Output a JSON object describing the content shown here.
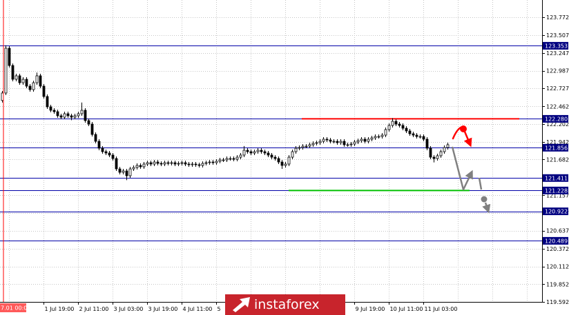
{
  "logo": {
    "text": "instaforex"
  },
  "colors": {
    "background": "#ffffff",
    "grid": "#c4c4c4",
    "axis_line": "#000000",
    "axis_text": "#000000",
    "level_line": "#0000a8",
    "level_label_bg": "#000080",
    "level_label_text": "#ffffff",
    "bull_body": "#ffffff",
    "bear_body": "#000000",
    "candle_outline": "#000000",
    "period_separator": "#ff0000",
    "period_label_bg": "#ff5a5a",
    "period_label_text": "#ffffff",
    "resistance": "#ff0000",
    "support": "#00c000",
    "forecast_arrow_red": "#ff0000",
    "forecast_arrow_gray": "#808080",
    "logo_bg": "#c8242c",
    "logo_text": "#ffffff"
  },
  "chart_data": {
    "type": "bar",
    "style": "candlestick",
    "ylim": [
      119.592,
      124.025
    ],
    "grid": true,
    "y_ticks": [
      "123.772",
      "123.507",
      "123.247",
      "122.987",
      "122.727",
      "122.462",
      "122.202",
      "121.942",
      "121.682",
      "121.157",
      "120.897",
      "120.637",
      "120.372",
      "120.112",
      "119.852",
      "119.592"
    ],
    "x_ticks": [
      {
        "label": "1 Jul 19:00",
        "index": 12
      },
      {
        "label": "2 Jul 11:00",
        "index": 22
      },
      {
        "label": "3 Jul 03:00",
        "index": 32
      },
      {
        "label": "3 Jul 19:00",
        "index": 42
      },
      {
        "label": "4 Jul 11:00",
        "index": 52
      },
      {
        "label": "5",
        "index": 62
      },
      {
        "label": "9 Jul 19:00",
        "index": 102
      },
      {
        "label": "10 Jul 11:00",
        "index": 112
      },
      {
        "label": "11 Jul 03:00",
        "index": 122
      }
    ],
    "period_separator": {
      "label": "7.01 00:00"
    },
    "levels": [
      "123.353",
      "122.280",
      "121.856",
      "121.411",
      "121.228",
      "120.922",
      "120.489"
    ],
    "annotations": {
      "resistance_level": 122.28,
      "support_level": 121.228
    },
    "candles": [
      [
        122.55,
        122.689,
        122.52,
        122.659
      ],
      [
        122.659,
        123.36,
        122.629,
        123.317
      ],
      [
        123.317,
        123.347,
        123.033,
        123.063
      ],
      [
        123.063,
        123.093,
        122.831,
        122.861
      ],
      [
        122.861,
        122.942,
        122.831,
        122.912
      ],
      [
        122.912,
        122.942,
        122.78,
        122.81
      ],
      [
        122.81,
        122.891,
        122.78,
        122.861
      ],
      [
        122.861,
        122.891,
        122.73,
        122.76
      ],
      [
        122.76,
        122.79,
        122.679,
        122.709
      ],
      [
        122.709,
        122.84,
        122.679,
        122.81
      ],
      [
        122.81,
        122.96,
        122.78,
        122.912
      ],
      [
        122.912,
        122.942,
        122.73,
        122.76
      ],
      [
        122.76,
        122.79,
        122.578,
        122.608
      ],
      [
        122.608,
        122.638,
        122.426,
        122.456
      ],
      [
        122.456,
        122.486,
        122.376,
        122.406
      ],
      [
        122.406,
        122.436,
        122.355,
        122.385
      ],
      [
        122.385,
        122.415,
        122.295,
        122.325
      ],
      [
        122.325,
        122.355,
        122.274,
        122.304
      ],
      [
        122.304,
        122.385,
        122.274,
        122.355
      ],
      [
        122.355,
        122.385,
        122.295,
        122.325
      ],
      [
        122.325,
        122.355,
        122.26,
        122.304
      ],
      [
        122.304,
        122.355,
        122.274,
        122.325
      ],
      [
        122.325,
        122.385,
        122.295,
        122.355
      ],
      [
        122.355,
        122.52,
        122.325,
        122.406
      ],
      [
        122.406,
        122.436,
        122.224,
        122.254
      ],
      [
        122.254,
        122.284,
        122.173,
        122.203
      ],
      [
        122.203,
        122.233,
        122.021,
        122.051
      ],
      [
        122.051,
        122.081,
        121.92,
        121.95
      ],
      [
        121.95,
        121.98,
        121.819,
        121.849
      ],
      [
        121.849,
        121.879,
        121.768,
        121.798
      ],
      [
        121.798,
        121.828,
        121.748,
        121.778
      ],
      [
        121.778,
        121.808,
        121.718,
        121.748
      ],
      [
        121.748,
        121.778,
        121.667,
        121.697
      ],
      [
        121.697,
        121.727,
        121.515,
        121.545
      ],
      [
        121.545,
        121.575,
        121.465,
        121.495
      ],
      [
        121.495,
        121.545,
        121.465,
        121.515
      ],
      [
        121.515,
        121.545,
        121.38,
        121.444
      ],
      [
        121.444,
        121.575,
        121.414,
        121.545
      ],
      [
        121.545,
        121.596,
        121.515,
        121.566
      ],
      [
        121.566,
        121.626,
        121.536,
        121.596
      ],
      [
        121.596,
        121.626,
        121.546,
        121.576
      ],
      [
        121.576,
        121.646,
        121.546,
        121.616
      ],
      [
        121.616,
        121.666,
        121.586,
        121.636
      ],
      [
        121.636,
        121.666,
        121.586,
        121.616
      ],
      [
        121.616,
        121.676,
        121.586,
        121.646
      ],
      [
        121.646,
        121.676,
        121.596,
        121.626
      ],
      [
        121.626,
        121.656,
        121.586,
        121.616
      ],
      [
        121.616,
        121.666,
        121.586,
        121.636
      ],
      [
        121.636,
        121.666,
        121.596,
        121.626
      ],
      [
        121.626,
        121.666,
        121.596,
        121.636
      ],
      [
        121.636,
        121.666,
        121.586,
        121.616
      ],
      [
        121.616,
        121.656,
        121.586,
        121.626
      ],
      [
        121.626,
        121.666,
        121.596,
        121.636
      ],
      [
        121.636,
        121.666,
        121.586,
        121.616
      ],
      [
        121.616,
        121.646,
        121.576,
        121.606
      ],
      [
        121.606,
        121.646,
        121.576,
        121.616
      ],
      [
        121.616,
        121.646,
        121.576,
        121.606
      ],
      [
        121.606,
        121.636,
        121.566,
        121.596
      ],
      [
        121.596,
        121.656,
        121.566,
        121.626
      ],
      [
        121.626,
        121.666,
        121.596,
        121.636
      ],
      [
        121.636,
        121.676,
        121.606,
        121.646
      ],
      [
        121.646,
        121.676,
        121.606,
        121.636
      ],
      [
        121.636,
        121.687,
        121.606,
        121.657
      ],
      [
        121.657,
        121.707,
        121.627,
        121.677
      ],
      [
        121.677,
        121.707,
        121.647,
        121.677
      ],
      [
        121.677,
        121.727,
        121.647,
        121.697
      ],
      [
        121.697,
        121.727,
        121.667,
        121.697
      ],
      [
        121.697,
        121.727,
        121.657,
        121.687
      ],
      [
        121.687,
        121.747,
        121.657,
        121.717
      ],
      [
        121.717,
        121.778,
        121.687,
        121.748
      ],
      [
        121.748,
        121.88,
        121.718,
        121.819
      ],
      [
        121.819,
        121.849,
        121.768,
        121.798
      ],
      [
        121.798,
        121.828,
        121.748,
        121.778
      ],
      [
        121.778,
        121.828,
        121.748,
        121.798
      ],
      [
        121.798,
        121.849,
        121.768,
        121.819
      ],
      [
        121.819,
        121.849,
        121.768,
        121.798
      ],
      [
        121.798,
        121.828,
        121.748,
        121.778
      ],
      [
        121.778,
        121.808,
        121.718,
        121.748
      ],
      [
        121.748,
        121.778,
        121.687,
        121.717
      ],
      [
        121.717,
        121.747,
        121.667,
        121.697
      ],
      [
        121.697,
        121.727,
        121.616,
        121.646
      ],
      [
        121.646,
        121.676,
        121.545,
        121.596
      ],
      [
        121.596,
        121.646,
        121.566,
        121.616
      ],
      [
        121.616,
        121.747,
        121.586,
        121.717
      ],
      [
        121.717,
        121.828,
        121.687,
        121.798
      ],
      [
        121.798,
        121.879,
        121.768,
        121.849
      ],
      [
        121.849,
        121.889,
        121.819,
        121.859
      ],
      [
        121.859,
        121.909,
        121.829,
        121.879
      ],
      [
        121.879,
        121.909,
        121.849,
        121.879
      ],
      [
        121.879,
        121.93,
        121.849,
        121.9
      ],
      [
        121.9,
        121.95,
        121.87,
        121.92
      ],
      [
        121.92,
        121.96,
        121.89,
        121.93
      ],
      [
        121.93,
        121.98,
        121.9,
        121.95
      ],
      [
        121.95,
        122.011,
        121.92,
        121.981
      ],
      [
        121.981,
        122.011,
        121.94,
        121.97
      ],
      [
        121.97,
        122.0,
        121.92,
        121.95
      ],
      [
        121.95,
        121.98,
        121.92,
        121.95
      ],
      [
        121.95,
        121.98,
        121.9,
        121.93
      ],
      [
        121.93,
        121.98,
        121.9,
        121.95
      ],
      [
        121.95,
        121.98,
        121.87,
        121.9
      ],
      [
        121.9,
        121.93,
        121.87,
        121.9
      ],
      [
        121.9,
        121.94,
        121.87,
        121.91
      ],
      [
        121.91,
        121.97,
        121.88,
        121.94
      ],
      [
        121.94,
        121.99,
        121.91,
        121.96
      ],
      [
        121.96,
        122.011,
        121.93,
        121.981
      ],
      [
        121.981,
        122.011,
        121.92,
        121.95
      ],
      [
        121.95,
        122.011,
        121.92,
        121.981
      ],
      [
        121.981,
        122.031,
        121.951,
        122.001
      ],
      [
        122.001,
        122.051,
        121.971,
        122.021
      ],
      [
        122.021,
        122.051,
        121.991,
        122.021
      ],
      [
        122.021,
        122.071,
        121.991,
        122.041
      ],
      [
        122.041,
        122.152,
        122.011,
        122.122
      ],
      [
        122.122,
        122.213,
        122.092,
        122.183
      ],
      [
        122.183,
        122.29,
        122.153,
        122.244
      ],
      [
        122.244,
        122.274,
        122.173,
        122.203
      ],
      [
        122.203,
        122.233,
        122.153,
        122.183
      ],
      [
        122.183,
        122.213,
        122.112,
        122.142
      ],
      [
        122.142,
        122.172,
        122.072,
        122.102
      ],
      [
        122.102,
        122.132,
        122.031,
        122.061
      ],
      [
        122.061,
        122.091,
        122.011,
        122.041
      ],
      [
        122.041,
        122.071,
        121.991,
        122.021
      ],
      [
        122.021,
        122.051,
        121.991,
        122.021
      ],
      [
        122.021,
        122.051,
        121.951,
        121.981
      ],
      [
        121.981,
        122.011,
        121.819,
        121.849
      ],
      [
        121.849,
        121.879,
        121.687,
        121.717
      ],
      [
        121.717,
        121.747,
        121.64,
        121.697
      ],
      [
        121.697,
        121.768,
        121.667,
        121.738
      ],
      [
        121.738,
        121.828,
        121.708,
        121.798
      ],
      [
        121.798,
        121.889,
        121.768,
        121.859
      ],
      [
        121.859,
        121.93,
        121.829,
        121.9
      ]
    ]
  }
}
